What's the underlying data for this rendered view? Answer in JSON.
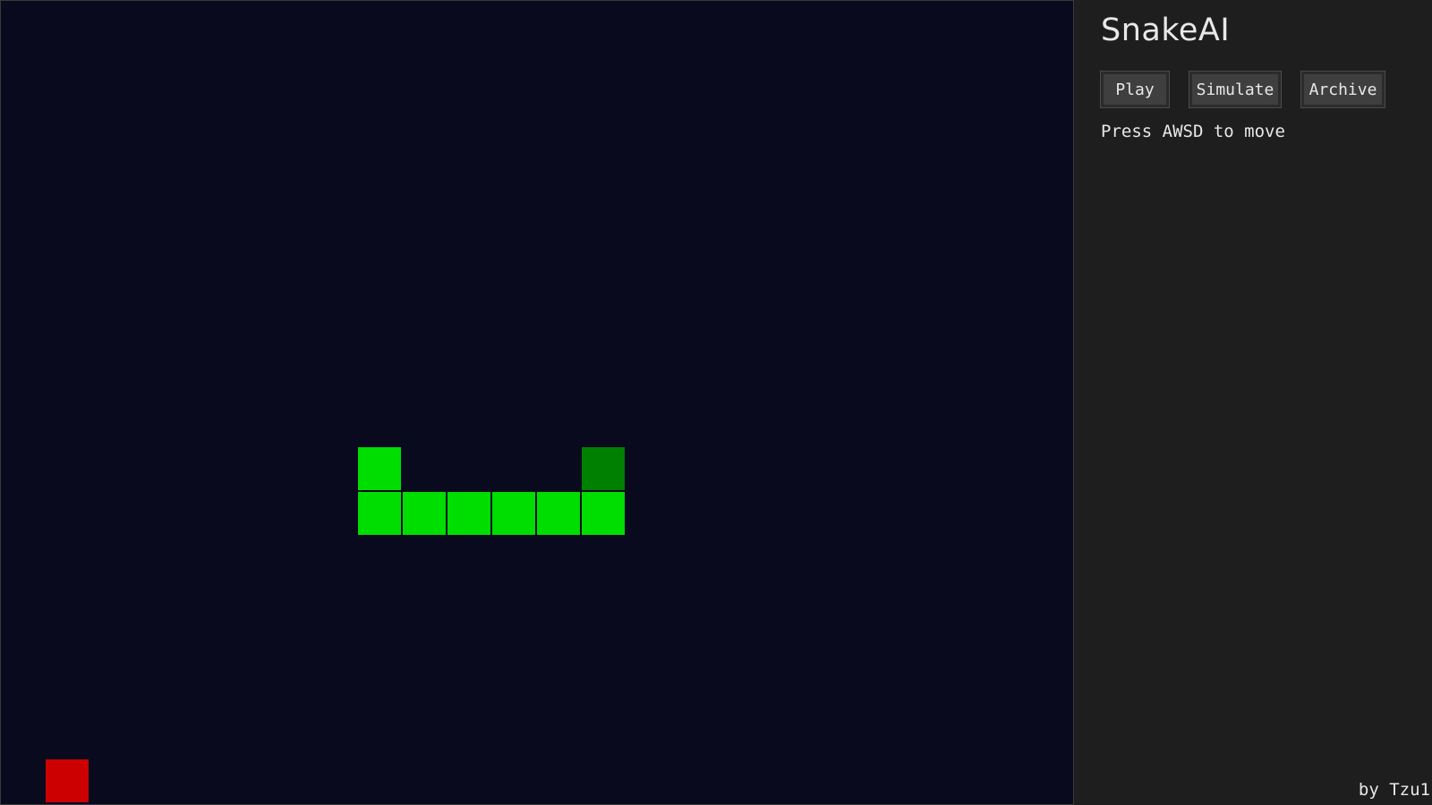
{
  "app": {
    "title": "SnakeAI"
  },
  "controls": {
    "play_label": "Play",
    "simulate_label": "Simulate",
    "archive_label": "Archive"
  },
  "instructions": "Press AWSD to move",
  "credit": "by Tzu1",
  "board": {
    "columns": 24,
    "rows": 18,
    "background_color": "#090a1e",
    "snake_color": "#00dd00",
    "head_color": "#008000",
    "food_color": "#cc0000",
    "snake": [
      {
        "col": 13,
        "row": 10,
        "part": "head"
      },
      {
        "col": 13,
        "row": 11,
        "part": "body"
      },
      {
        "col": 12,
        "row": 11,
        "part": "body"
      },
      {
        "col": 11,
        "row": 11,
        "part": "body"
      },
      {
        "col": 10,
        "row": 11,
        "part": "body"
      },
      {
        "col": 9,
        "row": 11,
        "part": "body"
      },
      {
        "col": 8,
        "row": 11,
        "part": "body"
      },
      {
        "col": 8,
        "row": 10,
        "part": "body"
      }
    ],
    "food": {
      "col": 1,
      "row": 17
    }
  }
}
